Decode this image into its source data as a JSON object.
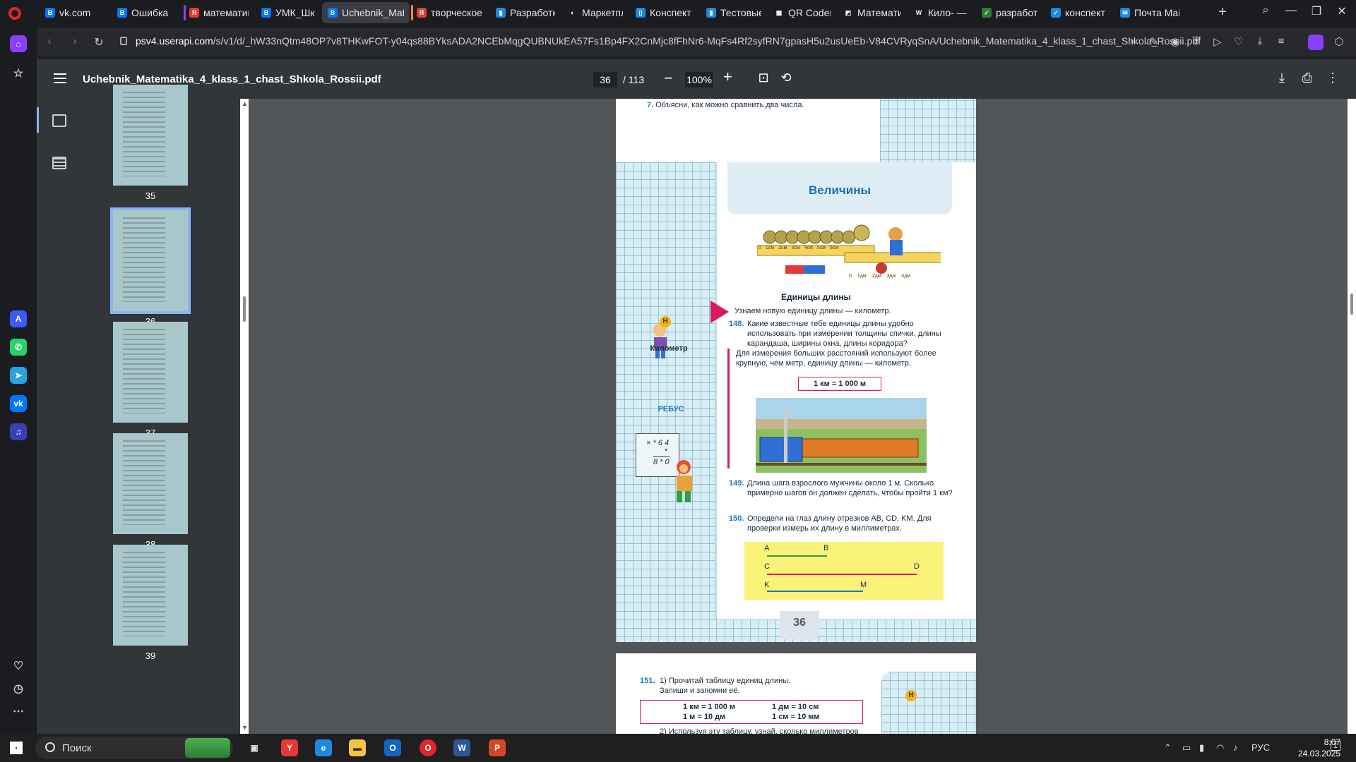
{
  "tabs": [
    {
      "title": "vk.com",
      "color": "#0077ff",
      "letter": "В",
      "group": ""
    },
    {
      "title": "Ошибка",
      "color": "#0077ff",
      "letter": "В",
      "group": ""
    },
    {
      "title": "математика",
      "color": "#e53935",
      "letter": "Я",
      "group": "#8a3ffc"
    },
    {
      "title": "УМК_Шк",
      "color": "#0077ff",
      "letter": "В",
      "group": ""
    },
    {
      "title": "Uchebnik_Matemati",
      "color": "#0077ff",
      "letter": "В",
      "group": ""
    },
    {
      "title": "творческое",
      "color": "#e53935",
      "letter": "Я",
      "group": "#f28b30"
    },
    {
      "title": "Разработка",
      "color": "#1e88e5",
      "letter": "▮",
      "group": ""
    },
    {
      "title": "Маркетплей",
      "color": "#ffffff",
      "letter": "◐",
      "group": ""
    },
    {
      "title": "Конспект ур",
      "color": "#1e88e5",
      "letter": "▯",
      "group": ""
    },
    {
      "title": "Тестовые за",
      "color": "#1e88e5",
      "letter": "▮",
      "group": ""
    },
    {
      "title": "QR Coder -",
      "color": "#ffffff",
      "letter": "▦",
      "group": ""
    },
    {
      "title": "Математика",
      "color": "#ffffff",
      "letter": "◩",
      "group": ""
    },
    {
      "title": "Кило- — Ви",
      "color": "#ffffff",
      "letter": "W",
      "group": ""
    },
    {
      "title": "разработка",
      "color": "#2e7d32",
      "letter": "✓",
      "group": ""
    },
    {
      "title": "конспект ур",
      "color": "#1e88e5",
      "letter": "✓",
      "group": ""
    },
    {
      "title": "Почта Mail",
      "color": "#1e88e5",
      "letter": "✉",
      "group": ""
    }
  ],
  "url": {
    "host": "psv4.userapi.com",
    "path": "/s/v1/d/_hW33nQtm48OP7v8THKwFOT-y04qs88BYksADA2NCEbMqgQUBNUkEA57Fs1Bp4FX2CnMjc8fFhNr6-MqFs4Rf2syfRN7gpasH5u2usUeEb-V84CVRyqSnA/Uchebnik_Matematika_4_klass_1_chast_Shkola_Rossii.pdf"
  },
  "pdf": {
    "title": "Uchebnik_Matematika_4_klass_1_chast_Shkola_Rossii.pdf",
    "page": "36",
    "total": "/ 113",
    "zoom": "100%"
  },
  "thumbs": [
    "35",
    "36",
    "37",
    "38",
    "39"
  ],
  "page35": {
    "q7": "7.",
    "q7text": "Объясни, как можно сравнить два числа.",
    "pagenum": "35"
  },
  "page36": {
    "header": "Величины",
    "subtitle": "Единицы длины",
    "intro": "Узнаем новую единицу длины — километр.",
    "q148num": "148.",
    "q148": "Какие известные тебе единицы длины удобно использовать при измерении толщины спички, длины карандаша, ширины окна, длины коридора?",
    "info": "Для измерения больших расстояний используют более крупную, чем метр, единицу длины — километр.",
    "equation": "1 км = 1 000 м",
    "q149num": "149.",
    "q149": "Длина шага взрослого мужчины около 1 м. Сколько примерно шагов он должен сделать, чтобы пройти 1 км?",
    "q150num": "150.",
    "q150": "Определи на глаз длину отрезков AB, CD, KM. Для проверки измерь их длину в миллиметрах.",
    "side_label": "Километр",
    "rebus": "РЕБУС",
    "rebus_top": "× * 6 4",
    "rebus_mid": "*",
    "rebus_bot": "8 * 0",
    "badge": "Н",
    "seg_a": "A",
    "seg_b": "B",
    "seg_c": "C",
    "seg_d": "D",
    "seg_k": "K",
    "seg_m": "M",
    "ruler1": [
      "0",
      "1см",
      "2см",
      "3см",
      "4см",
      "5см",
      "6см"
    ],
    "ruler2": [
      "0",
      "1дм",
      "2дм",
      "3дм",
      "4дм"
    ],
    "pagenum": "36"
  },
  "page37": {
    "q151num": "151.",
    "q151a": "1) Прочитай таблицу единиц длины.",
    "q151b": "Запиши и запомни её.",
    "t1": "1 км = 1 000 м",
    "t2": "1 дм = 10 см",
    "t3": "1 м = 10 дм",
    "t4": "1 см = 10 мм",
    "q151c": "2) Используя эту таблицу, узнай, сколько миллиметров",
    "badge": "Н"
  },
  "taskbar": {
    "search": "Поиск",
    "lang": "РУС",
    "time": "8:07",
    "date": "24.03.2025",
    "notif": "1"
  }
}
